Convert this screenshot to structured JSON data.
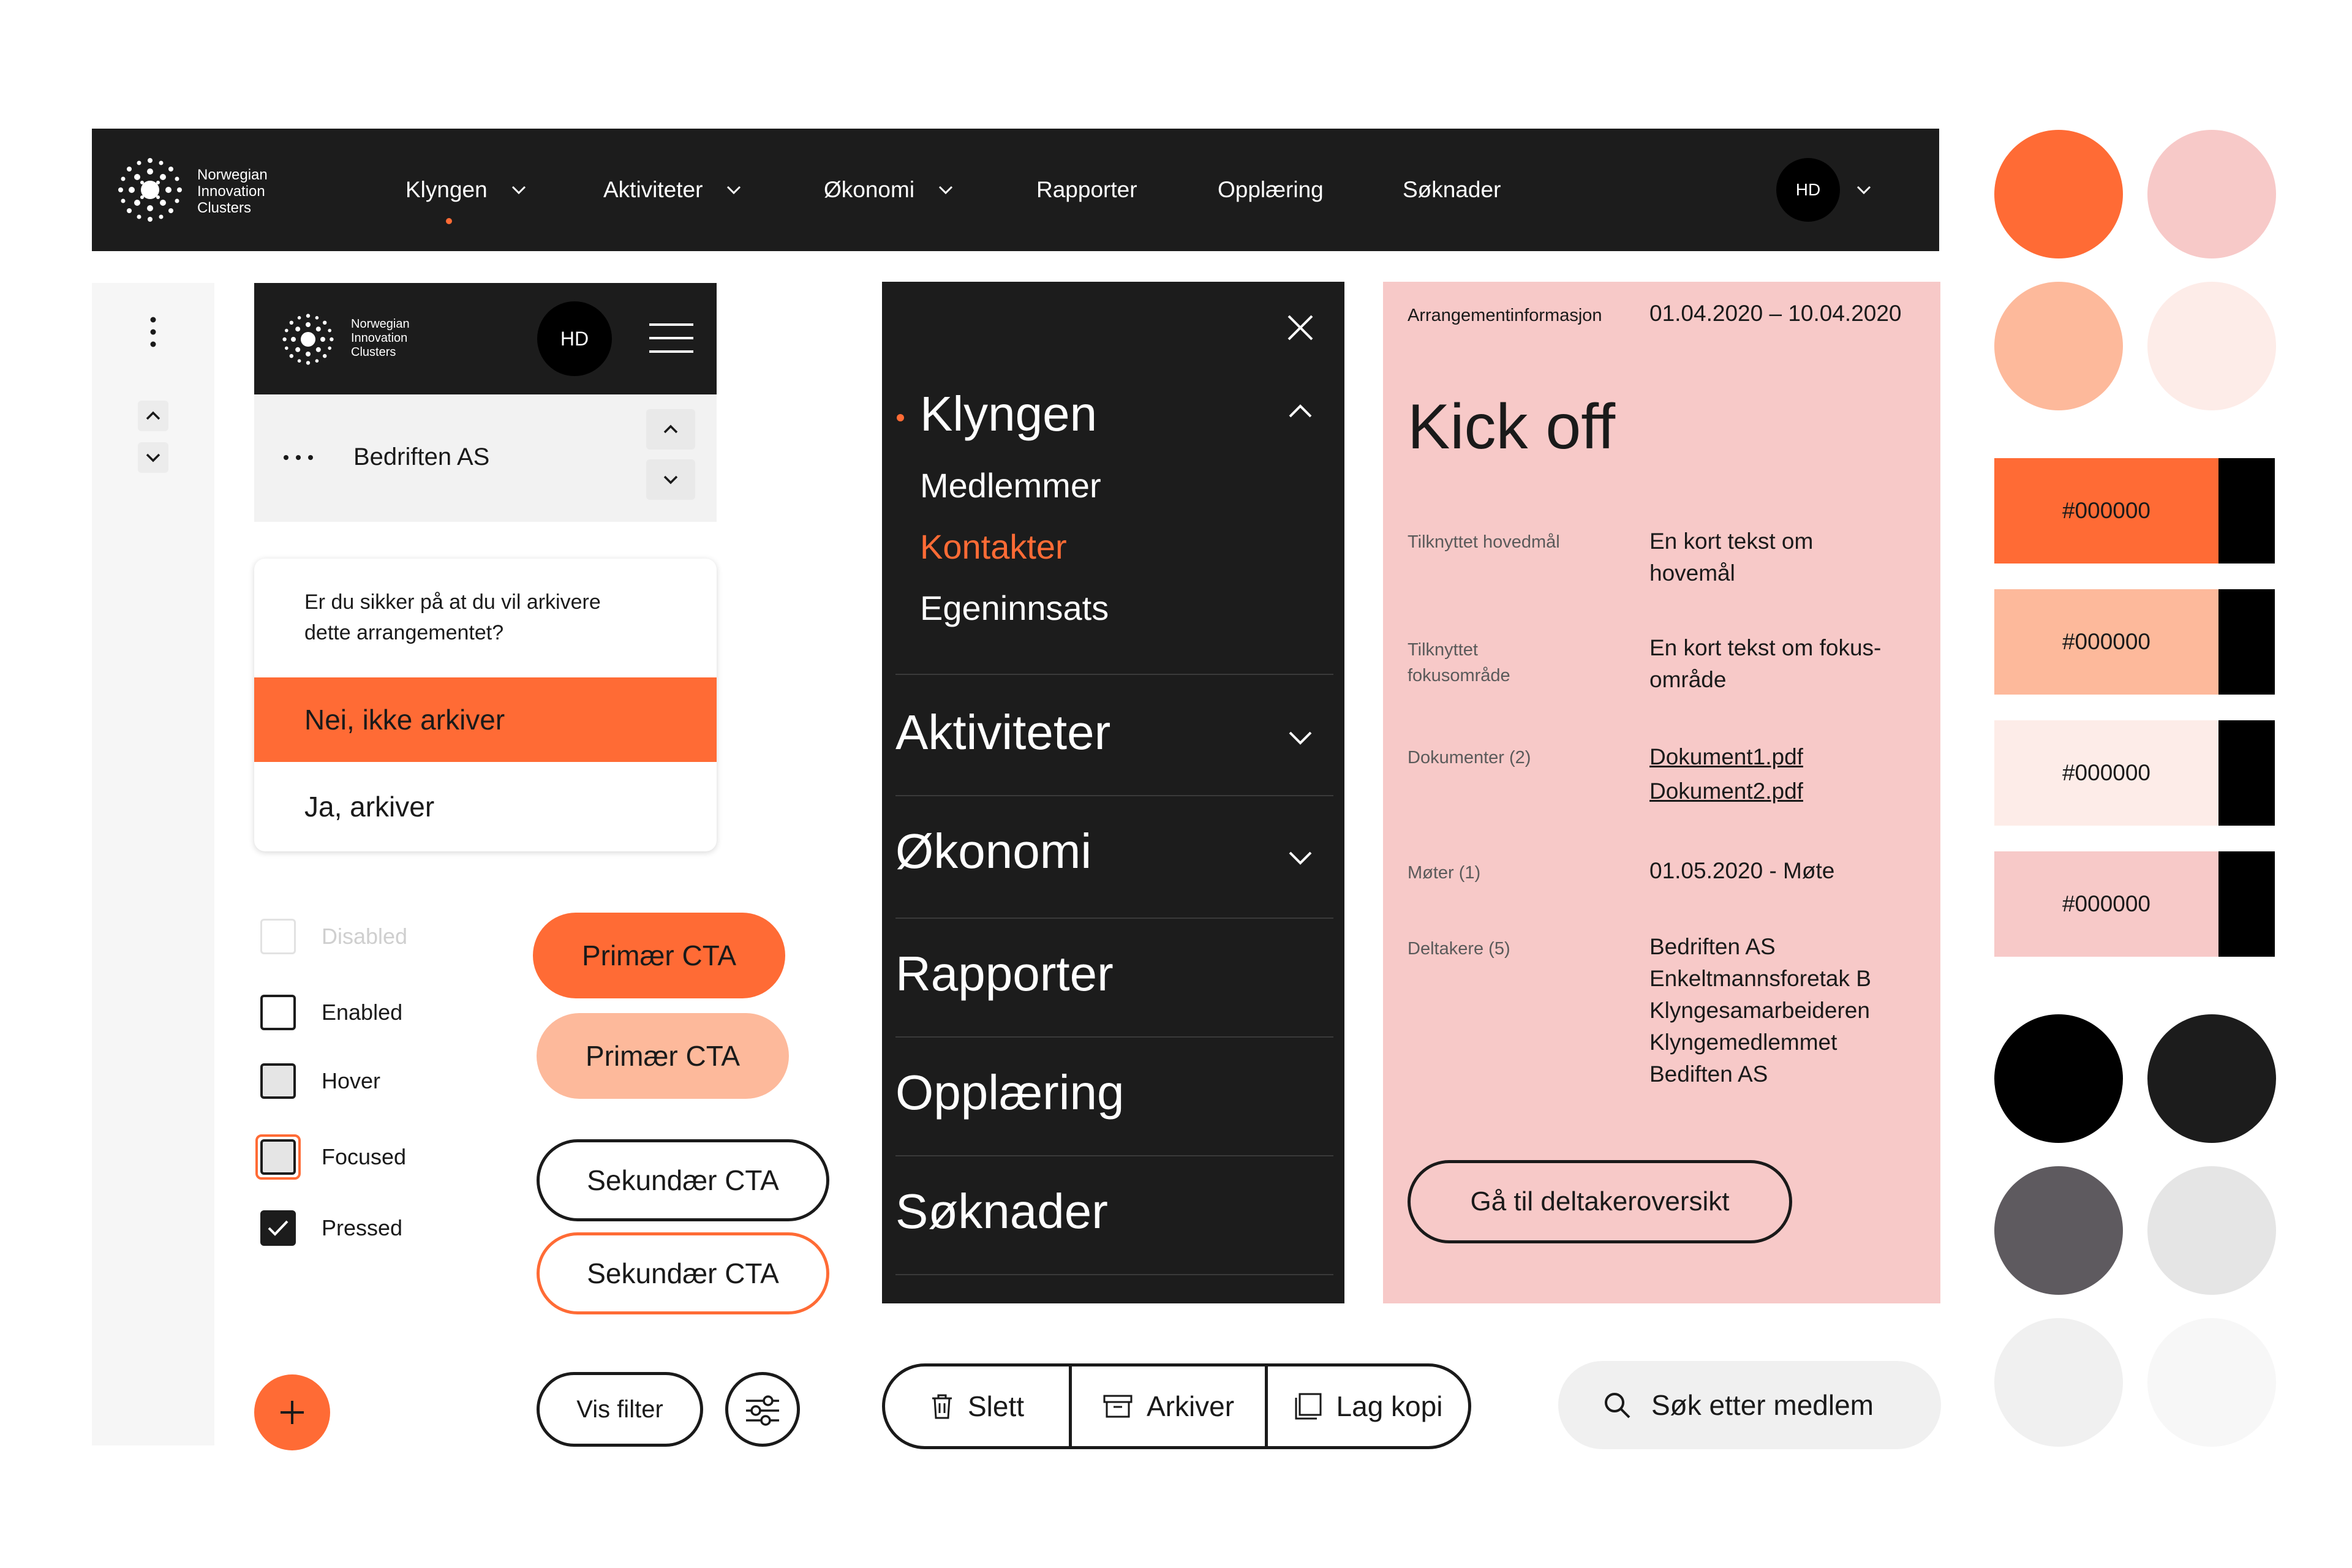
{
  "brand": {
    "line1": "Norwegian",
    "line2": "Innovation",
    "line3": "Clusters"
  },
  "navbar": {
    "items": [
      {
        "label": "Klyngen",
        "has_dropdown": true,
        "active": true
      },
      {
        "label": "Aktiviteter",
        "has_dropdown": true
      },
      {
        "label": "Økonomi",
        "has_dropdown": true
      },
      {
        "label": "Rapporter"
      },
      {
        "label": "Opplæring"
      },
      {
        "label": "Søknader"
      }
    ],
    "avatar": "HD",
    "avatar_icon": "chevron-down-icon"
  },
  "mobile": {
    "avatar": "HD",
    "menu_icon": "hamburger-icon",
    "company": "Bedriften AS",
    "more_icon": "more-horizontal-icon"
  },
  "dialog": {
    "question": "Er du sikker på at du vil arkivere dette arrangementet?",
    "no_label": "Nei, ikke arkiver",
    "yes_label": "Ja, arkiver"
  },
  "checkboxes": [
    {
      "label": "Disabled",
      "state": "disabled"
    },
    {
      "label": "Enabled",
      "state": "enabled"
    },
    {
      "label": "Hover",
      "state": "hover"
    },
    {
      "label": "Focused",
      "state": "focused"
    },
    {
      "label": "Pressed",
      "state": "pressed"
    }
  ],
  "buttons": {
    "primary1": "Primær CTA",
    "primary2": "Primær CTA",
    "secondary1": "Sekundær CTA",
    "secondary2": "Sekundær CTA",
    "filter": "Vis filter",
    "filter_icon": "sliders-icon",
    "fab_icon": "plus-icon"
  },
  "dark_menu": {
    "close_icon": "close-icon",
    "klyngen": "Klyngen",
    "sub": [
      "Medlemmer",
      "Kontakter",
      "Egeninnsats"
    ],
    "aktiviteter": "Aktiviteter",
    "okonomi": "Økonomi",
    "rapporter": "Rapporter",
    "opplaering": "Opplæring",
    "soknader": "Søknader"
  },
  "info_card": {
    "header_label": "Arrangementinformasjon",
    "date_range": "01.04.2020 – 10.04.2020",
    "title": "Kick off",
    "rows": {
      "hovedmal_label": "Tilknyttet hovedmål",
      "hovedmal_value_1": "En kort tekst om",
      "hovedmal_value_2": "hovemål",
      "fokus_label_1": "Tilknyttet",
      "fokus_label_2": "fokusområde",
      "fokus_value_1": "En kort tekst om fokus-",
      "fokus_value_2": "område",
      "dok_label": "Dokumenter (2)",
      "dok_1": "Dokument1.pdf",
      "dok_2": "Dokument2.pdf",
      "moter_label": "Møter (1)",
      "moter_value": "01.05.2020 - Møte",
      "deltakere_label": "Deltakere (5)",
      "deltakere": [
        "Bedriften AS",
        "Enkeltmannsforetak B",
        "Klyngesamarbeideren",
        "Klyngemedlemmet",
        "Bediften AS"
      ]
    },
    "cta": "Gå til deltakeroversikt"
  },
  "palette": {
    "circles_top": [
      "#ff6b35",
      "#f7c9c8",
      "#fdb99b",
      "#fdece8"
    ],
    "swatches": [
      {
        "label": "#000000",
        "color": "#ff6b35"
      },
      {
        "label": "#000000",
        "color": "#fdb99b"
      },
      {
        "label": "#000000",
        "color": "#fdece8"
      },
      {
        "label": "#000000",
        "color": "#f7c9c8"
      }
    ],
    "circles_bottom": [
      "#000000",
      "#1c1c1c",
      "#5e5a5f",
      "#e5e5e5",
      "#f0f0f0",
      "#f7f7f7"
    ]
  },
  "actions": {
    "delete": "Slett",
    "delete_icon": "trash-icon",
    "archive": "Arkiver",
    "archive_icon": "archive-icon",
    "copy": "Lag kopi",
    "copy_icon": "copy-icon"
  },
  "search": {
    "label": "Søk etter medlem",
    "icon": "search-icon"
  },
  "colors": {
    "accent": "#ff6b35",
    "dark": "#1c1c1c",
    "pink": "#f7c9c8",
    "peach": "#fdb99b"
  }
}
